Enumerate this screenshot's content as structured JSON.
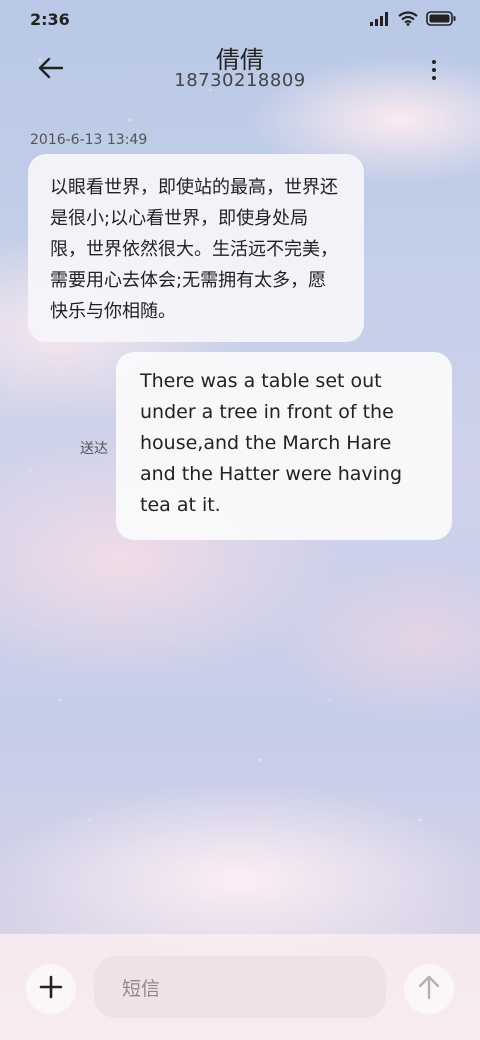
{
  "status_bar": {
    "time": "2:36",
    "icons": [
      "signal-icon",
      "wifi-icon",
      "battery-icon"
    ]
  },
  "header": {
    "contact_name": "倩倩",
    "phone_number": "18730218809",
    "back_icon": "back-arrow-icon",
    "more_icon": "more-vertical-icon"
  },
  "conversation": {
    "timestamp": "2016-6-13 13:49",
    "messages": [
      {
        "direction": "incoming",
        "text": "以眼看世界，即使站的最高，世界还是很小;以心看世界，即使身处局限，世界依然很大。生活远不完美，需要用心去体会;无需拥有太多，愿快乐与你相随。"
      },
      {
        "direction": "outgoing",
        "status": "送达",
        "text": "There was a table set out under a tree in front of the house,and the March Hare and the Hatter were having tea at it."
      }
    ]
  },
  "composer": {
    "placeholder": "短信",
    "add_icon": "plus-icon",
    "send_icon": "arrow-up-icon"
  },
  "colors": {
    "text_primary": "#222222",
    "bubble_bg": "#f6f5fa",
    "composer_bg": "#f7ecf0",
    "input_bg": "#efe1e6"
  }
}
